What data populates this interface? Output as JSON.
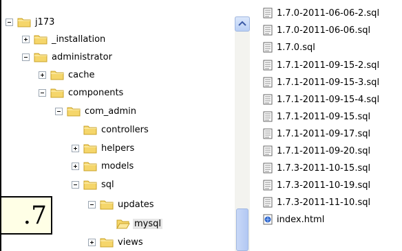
{
  "tree": {
    "items": [
      {
        "label": "j173",
        "expander": "minus"
      },
      {
        "label": "_installation",
        "expander": "plus"
      },
      {
        "label": "administrator",
        "expander": "minus"
      },
      {
        "label": "cache",
        "expander": "plus"
      },
      {
        "label": "components",
        "expander": "minus"
      },
      {
        "label": "com_admin",
        "expander": "minus"
      },
      {
        "label": "controllers",
        "expander": "none"
      },
      {
        "label": "helpers",
        "expander": "plus"
      },
      {
        "label": "models",
        "expander": "plus"
      },
      {
        "label": "sql",
        "expander": "minus"
      },
      {
        "label": "updates",
        "expander": "minus"
      },
      {
        "label": "mysql",
        "expander": "none",
        "selected": true,
        "open": true
      },
      {
        "label": "views",
        "expander": "plus"
      }
    ]
  },
  "files": [
    {
      "name": "1.7.0-2011-06-06-2.sql",
      "type": "sql"
    },
    {
      "name": "1.7.0-2011-06-06.sql",
      "type": "sql"
    },
    {
      "name": "1.7.0.sql",
      "type": "sql"
    },
    {
      "name": "1.7.1-2011-09-15-2.sql",
      "type": "sql"
    },
    {
      "name": "1.7.1-2011-09-15-3.sql",
      "type": "sql"
    },
    {
      "name": "1.7.1-2011-09-15-4.sql",
      "type": "sql"
    },
    {
      "name": "1.7.1-2011-09-15.sql",
      "type": "sql"
    },
    {
      "name": "1.7.1-2011-09-17.sql",
      "type": "sql"
    },
    {
      "name": "1.7.1-2011-09-20.sql",
      "type": "sql"
    },
    {
      "name": "1.7.3-2011-10-15.sql",
      "type": "sql"
    },
    {
      "name": "1.7.3-2011-10-19.sql",
      "type": "sql"
    },
    {
      "name": "1.7.3-2011-11-10.sql",
      "type": "sql"
    },
    {
      "name": "index.html",
      "type": "html"
    }
  ],
  "overlay": {
    "version_text": ".7"
  },
  "colors": {
    "folder": "#f5d66b",
    "folder_edge": "#c9a227",
    "selection": "#e6e6e6"
  }
}
